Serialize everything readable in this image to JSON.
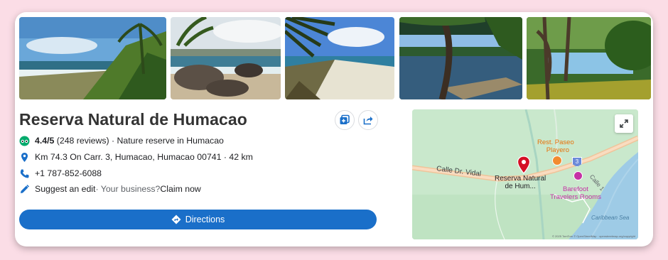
{
  "place": {
    "name": "Reserva Natural de Humacao",
    "rating": "4.4/5",
    "reviews": "(248 reviews)",
    "category": "· Nature reserve in Humacao",
    "address": "Km 74.3 On Carr. 3, Humacao, Humacao 00741 · 42 km",
    "phone": "+1 787-852-6088",
    "suggest_edit": "Suggest an edit",
    "business_prompt": " · Your business?",
    "claim": " Claim now"
  },
  "actions": {
    "directions_label": "Directions"
  },
  "icons": {
    "rating": "tripadvisor-owl-icon",
    "address": "map-pin-icon",
    "phone": "phone-icon",
    "edit": "pencil-icon",
    "save": "add-to-collection-icon",
    "share": "share-icon",
    "directions": "directions-icon",
    "expand": "expand-icon"
  },
  "map": {
    "labels": {
      "road_1": "Calle Dr. Vidal",
      "restaurant": "Rest. Paseo Playero",
      "restaurant_line1": "Rest. Paseo",
      "restaurant_line2": "Playero",
      "place_line1": "Reserva Natural",
      "place_line2": "de Hum...",
      "hotel_line1": "Barefoot",
      "hotel_line2": "Travelers Rooms",
      "road_2": "Calle 1",
      "shield": "3",
      "sea": "Caribbean Sea",
      "attribution": "© 2025 TomTom © OpenStreetMap · openstreetmap.org/copyright"
    }
  },
  "colors": {
    "accent": "#1a6fc9",
    "rating_icon": "#00aa6c",
    "pin": "#d50f25",
    "restaurant": "#e8710a",
    "hotel": "#c531a5"
  }
}
